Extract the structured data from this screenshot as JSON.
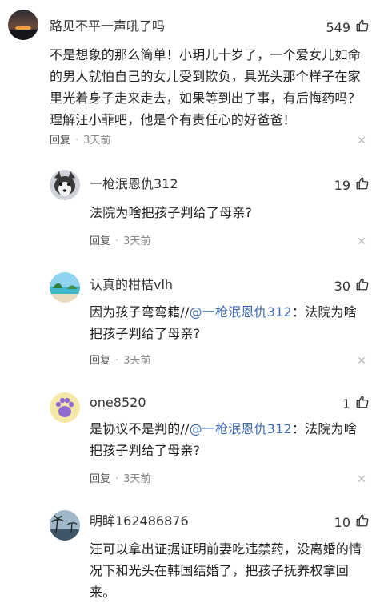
{
  "comments": [
    {
      "author": "路见不平一声吼了吗",
      "likes": "549",
      "content": "不是想象的那么简单！小玥儿十岁了，一个爱女儿如命的男人就怕自己的女儿受到欺负，具光头那个样子在家里光着身子走来走去，如果等到出了事，有后悔药吗？理解汪小菲吧，他是个有责任心的好爸爸！",
      "reply_label": "回复",
      "time": "3天前",
      "avatar": "sunset-avatar-icon"
    },
    {
      "author": "一枪泯恩仇312",
      "likes": "19",
      "content": "法院为啥把孩子判给了母亲?",
      "reply_label": "回复",
      "time": "3天前",
      "avatar": "husky-dog-avatar-icon"
    },
    {
      "author": "认真的柑桔vlh",
      "likes": "30",
      "content_prefix": "因为孩子弯弯籍//",
      "mention": "@一枪泯恩仇312",
      "content_suffix": "：法院为啥把孩子判给了母亲?",
      "reply_label": "回复",
      "time": "3天前",
      "avatar": "beach-avatar-icon"
    },
    {
      "author": "one8520",
      "likes": "1",
      "content_prefix": "是协议不是判的//",
      "mention": "@一枪泯恩仇312",
      "content_suffix": "：法院为啥把孩子判给了母亲?",
      "reply_label": "回复",
      "time": "3天前",
      "avatar": "paw-avatar-icon"
    },
    {
      "author": "明眸162486876",
      "likes": "10",
      "content": "汪可以拿出证据证明前妻吃违禁药，没离婚的情况下和光头在韩国结婚了，把孩子抚养权拿回来。",
      "avatar": "palm-avatar-icon"
    }
  ],
  "colors": {
    "mention": "#3d6ab0",
    "meta": "#888888"
  },
  "icons": {
    "like": "thumbs-up-icon",
    "dismiss": "close-icon"
  }
}
